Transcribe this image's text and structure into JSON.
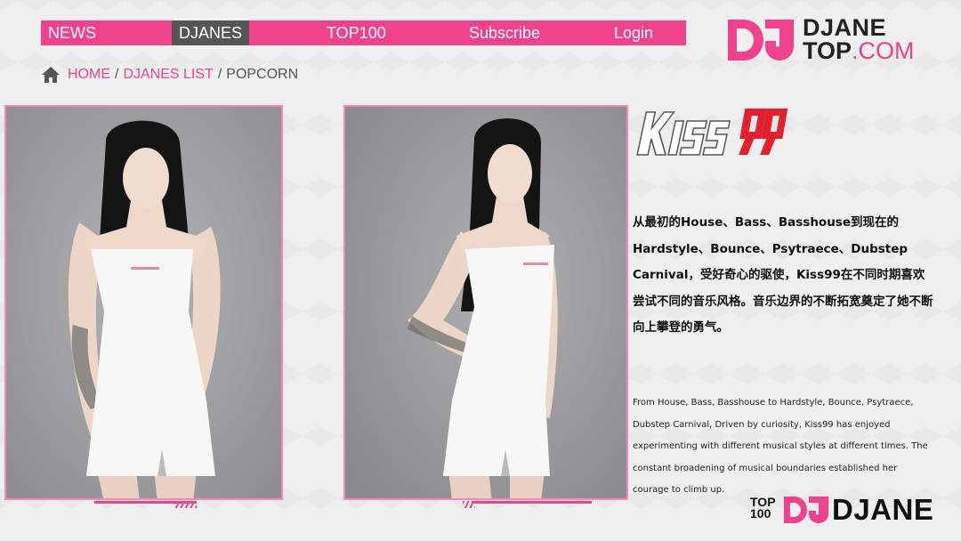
{
  "nav": {
    "items": [
      {
        "label": "NEWS"
      },
      {
        "label": "DJANES"
      },
      {
        "label": "TOP100"
      },
      {
        "label": "Subscribe"
      },
      {
        "label": "Login"
      }
    ],
    "active": "DJANES"
  },
  "logo": {
    "mark": "DJ",
    "line1": "DJANE",
    "line2_bold": "TOP",
    "line2_suffix": ".COM"
  },
  "breadcrumb": {
    "home": "HOME",
    "separator": "/",
    "list": "DJANES LIST",
    "current": "POPCORN"
  },
  "artist": {
    "logo_text": "KISS 99",
    "bio_cn": "从最初的House、Bass、Basshouse到现在的Hardstyle、Bounce、Psytraece、Dubstep Carnival，受好奇心的驱使，Kiss99在不同时期喜欢尝试不同的音乐风格。音乐边界的不断拓宽奠定了她不断向上攀登的勇气。",
    "bio_en": "From House, Bass, Basshouse to Hardstyle, Bounce, Psytraece, Dubstep Carnival, Driven by curiosity, Kiss99 has enjoyed experimenting with different musical styles at different times. The constant broadening of musical boundaries established her courage to climb up."
  },
  "bottom_logo": {
    "top": "TOP",
    "num": "100",
    "mark": "DJ",
    "name": "DJANE"
  },
  "colors": {
    "accent": "#f0418c",
    "nav_active": "#555555",
    "kiss_red": "#e5202e"
  },
  "icons": [
    "home-icon"
  ]
}
